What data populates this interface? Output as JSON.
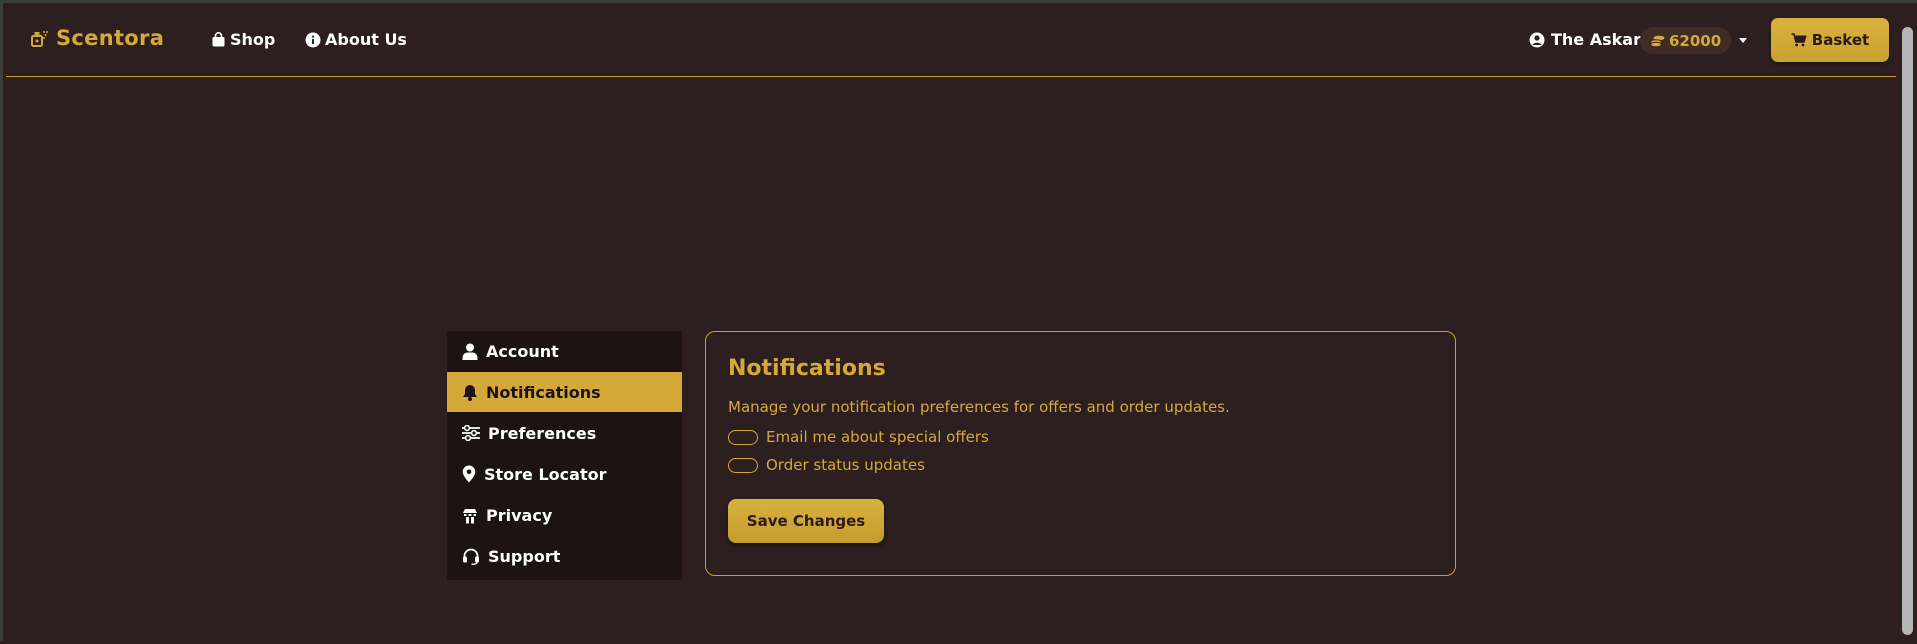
{
  "header": {
    "brand": "Scentora",
    "nav": [
      {
        "label": "Shop",
        "icon": "shopping-bag-icon"
      },
      {
        "label": "About Us",
        "icon": "info-circle-icon"
      }
    ],
    "user_name": "The Askar",
    "coins": "62000",
    "basket_label": "Basket"
  },
  "sidebar": {
    "items": [
      {
        "label": "Account",
        "icon": "user-icon",
        "active": false
      },
      {
        "label": "Notifications",
        "icon": "bell-icon",
        "active": true
      },
      {
        "label": "Preferences",
        "icon": "sliders-icon",
        "active": false
      },
      {
        "label": "Store Locator",
        "icon": "map-pin-icon",
        "active": false
      },
      {
        "label": "Privacy",
        "icon": "privacy-icon",
        "active": false
      },
      {
        "label": "Support",
        "icon": "headset-icon",
        "active": false
      }
    ]
  },
  "main": {
    "title": "Notifications",
    "description": "Manage your notification preferences for offers and order updates.",
    "toggles": [
      {
        "label": "Email me about special offers",
        "checked": false
      },
      {
        "label": "Order status updates",
        "checked": false
      }
    ],
    "save_label": "Save Changes"
  },
  "colors": {
    "background": "#2d1f1f",
    "accent": "#d4a93a",
    "sidebar": "#1c1312"
  }
}
